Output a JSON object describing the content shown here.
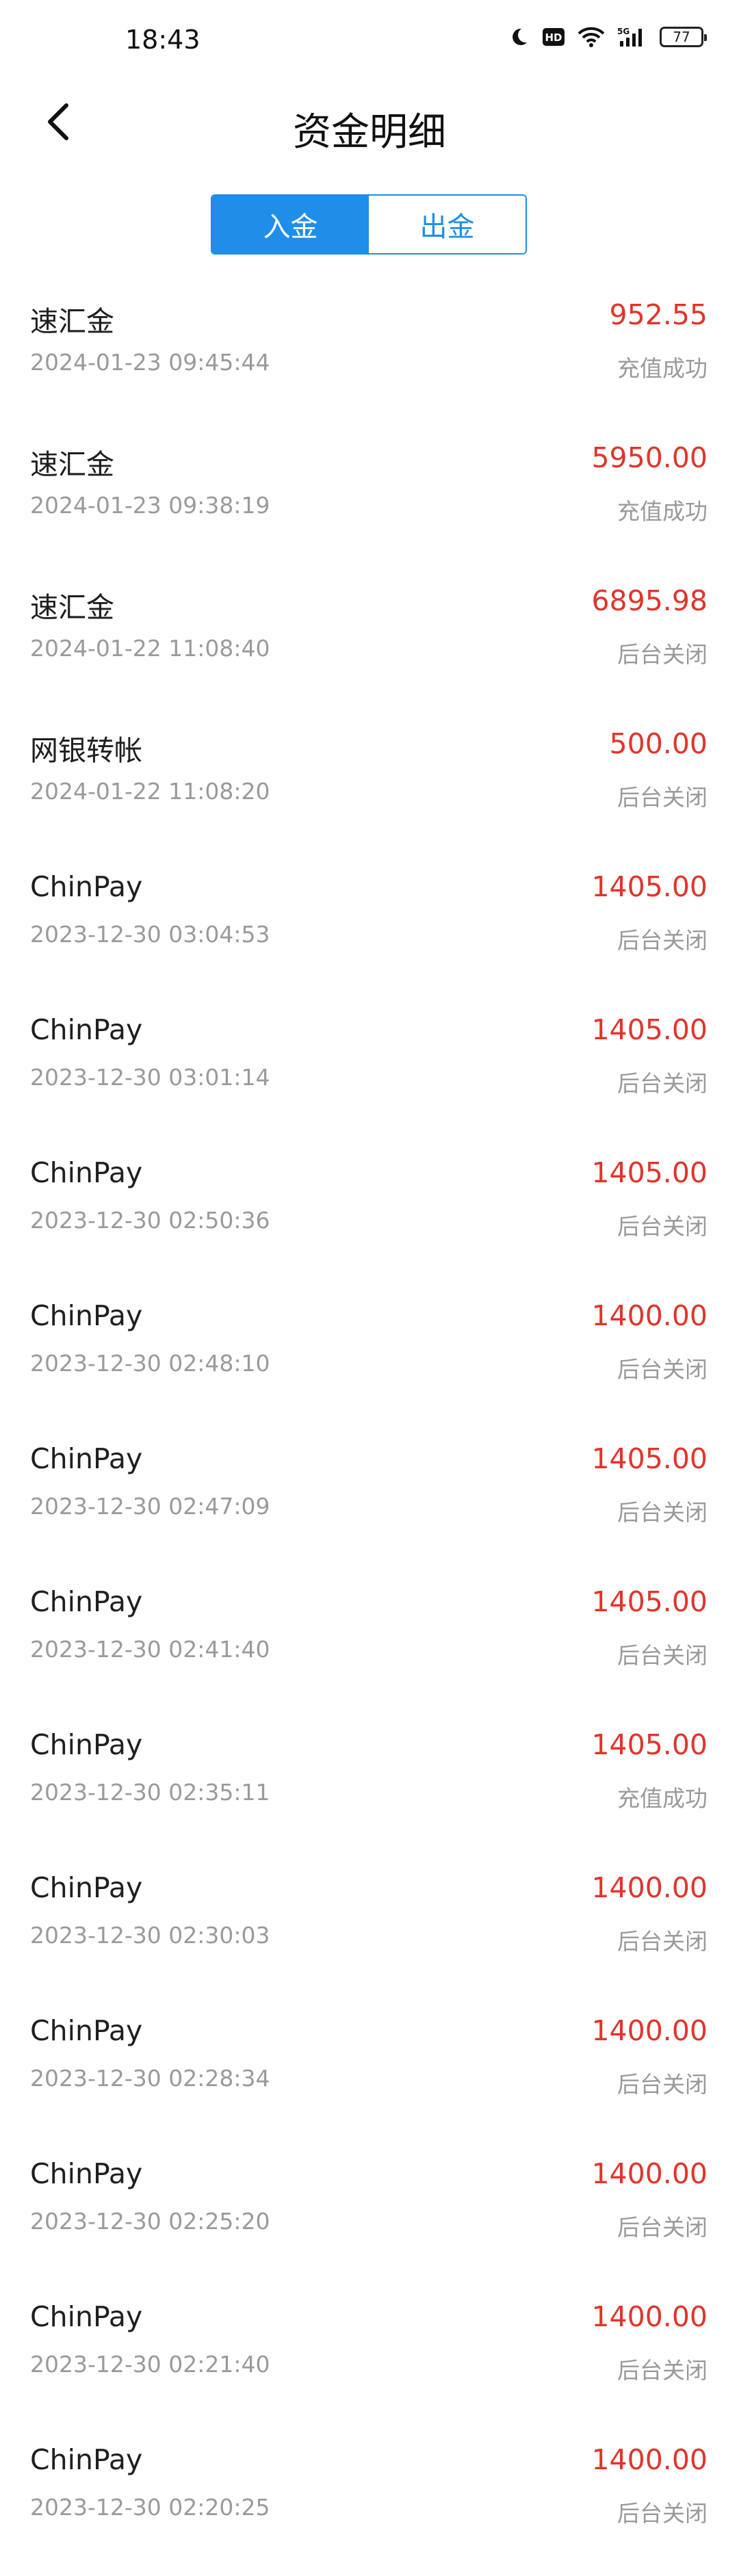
{
  "status_bar": {
    "time": "18:43",
    "battery": "77",
    "icons": [
      "moon-icon",
      "hd-icon",
      "wifi-icon",
      "5g-signal-icon",
      "battery-icon"
    ]
  },
  "header": {
    "title": "资金明细",
    "back_icon": "chevron-left-icon"
  },
  "tabs": [
    {
      "label": "入金",
      "active": true
    },
    {
      "label": "出金",
      "active": false
    }
  ],
  "colors": {
    "accent": "#1f8ee8",
    "amount": "#e0352b",
    "secondary_text": "#9a9a9a"
  },
  "records": [
    {
      "name": "速汇金",
      "time": "2024-01-23 09:45:44",
      "amount": "952.55",
      "status": "充值成功"
    },
    {
      "name": "速汇金",
      "time": "2024-01-23 09:38:19",
      "amount": "5950.00",
      "status": "充值成功"
    },
    {
      "name": "速汇金",
      "time": "2024-01-22 11:08:40",
      "amount": "6895.98",
      "status": "后台关闭"
    },
    {
      "name": "网银转帐",
      "time": "2024-01-22 11:08:20",
      "amount": "500.00",
      "status": "后台关闭"
    },
    {
      "name": "ChinPay",
      "time": "2023-12-30 03:04:53",
      "amount": "1405.00",
      "status": "后台关闭"
    },
    {
      "name": "ChinPay",
      "time": "2023-12-30 03:01:14",
      "amount": "1405.00",
      "status": "后台关闭"
    },
    {
      "name": "ChinPay",
      "time": "2023-12-30 02:50:36",
      "amount": "1405.00",
      "status": "后台关闭"
    },
    {
      "name": "ChinPay",
      "time": "2023-12-30 02:48:10",
      "amount": "1400.00",
      "status": "后台关闭"
    },
    {
      "name": "ChinPay",
      "time": "2023-12-30 02:47:09",
      "amount": "1405.00",
      "status": "后台关闭"
    },
    {
      "name": "ChinPay",
      "time": "2023-12-30 02:41:40",
      "amount": "1405.00",
      "status": "后台关闭"
    },
    {
      "name": "ChinPay",
      "time": "2023-12-30 02:35:11",
      "amount": "1405.00",
      "status": "充值成功"
    },
    {
      "name": "ChinPay",
      "time": "2023-12-30 02:30:03",
      "amount": "1400.00",
      "status": "后台关闭"
    },
    {
      "name": "ChinPay",
      "time": "2023-12-30 02:28:34",
      "amount": "1400.00",
      "status": "后台关闭"
    },
    {
      "name": "ChinPay",
      "time": "2023-12-30 02:25:20",
      "amount": "1400.00",
      "status": "后台关闭"
    },
    {
      "name": "ChinPay",
      "time": "2023-12-30 02:21:40",
      "amount": "1400.00",
      "status": "后台关闭"
    },
    {
      "name": "ChinPay",
      "time": "2023-12-30 02:20:25",
      "amount": "1400.00",
      "status": "后台关闭"
    }
  ]
}
